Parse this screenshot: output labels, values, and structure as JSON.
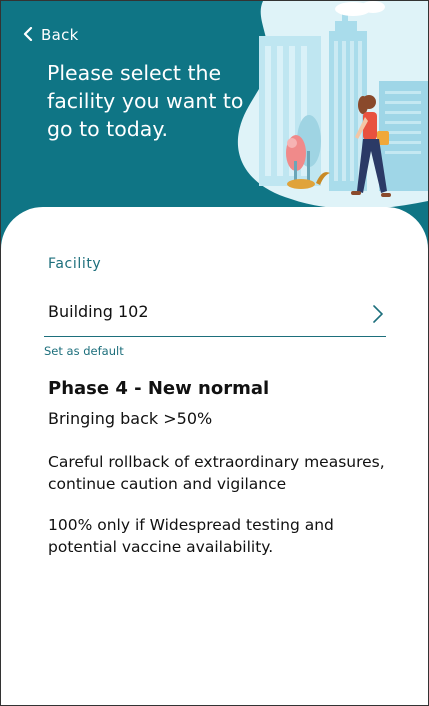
{
  "header": {
    "back_label": "Back",
    "title": "Please select the facility you want to go to today."
  },
  "facility": {
    "label": "Facility",
    "value": "Building 102",
    "set_default_label": "Set as default"
  },
  "phase": {
    "title": "Phase 4 - New normal",
    "subtitle": "Bringing back >50%",
    "paragraphs": [
      "Careful rollback of extraordinary measures, continue caution and vigilance",
      "100% only if Widespread testing and potential vaccine availability."
    ]
  },
  "colors": {
    "header_bg": "#0f7585",
    "accent": "#1d6f7c",
    "text": "#111111"
  },
  "icons": {
    "back": "chevron-left-icon",
    "select": "chevron-right-icon"
  }
}
